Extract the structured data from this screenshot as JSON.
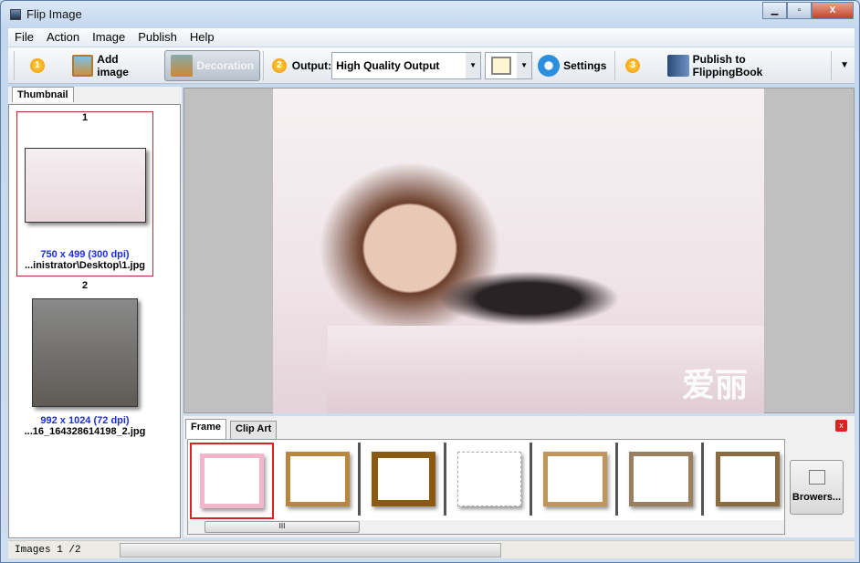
{
  "window": {
    "title": "Flip Image"
  },
  "menu": [
    "File",
    "Action",
    "Image",
    "Publish",
    "Help"
  ],
  "toolbar": {
    "step1": "1",
    "add_image": "Add image",
    "decoration": "Decoration",
    "step2": "2",
    "output_label": "Output:",
    "output_value": "High Quality Output",
    "settings": "Settings",
    "step3": "3",
    "publish": "Publish to FlippingBook"
  },
  "left_panel": {
    "tab": "Thumbnail",
    "items": [
      {
        "index": "1",
        "dims": "750 x 499 (300 dpi)",
        "path": "...inistrator\\Desktop\\1.jpg"
      },
      {
        "index": "2",
        "dims": "992 x 1024 (72 dpi)",
        "path": "...16_164328614198_2.jpg"
      }
    ]
  },
  "preview": {
    "watermark": "爱丽"
  },
  "bottom_panel": {
    "tabs": [
      "Frame",
      "Clip Art"
    ],
    "browse": "Browers...",
    "scroll_grip": "III"
  },
  "status": {
    "text": "Images 1 /2"
  },
  "colors": {
    "accent": "#1a2de6",
    "selected_border": "#e02020"
  }
}
